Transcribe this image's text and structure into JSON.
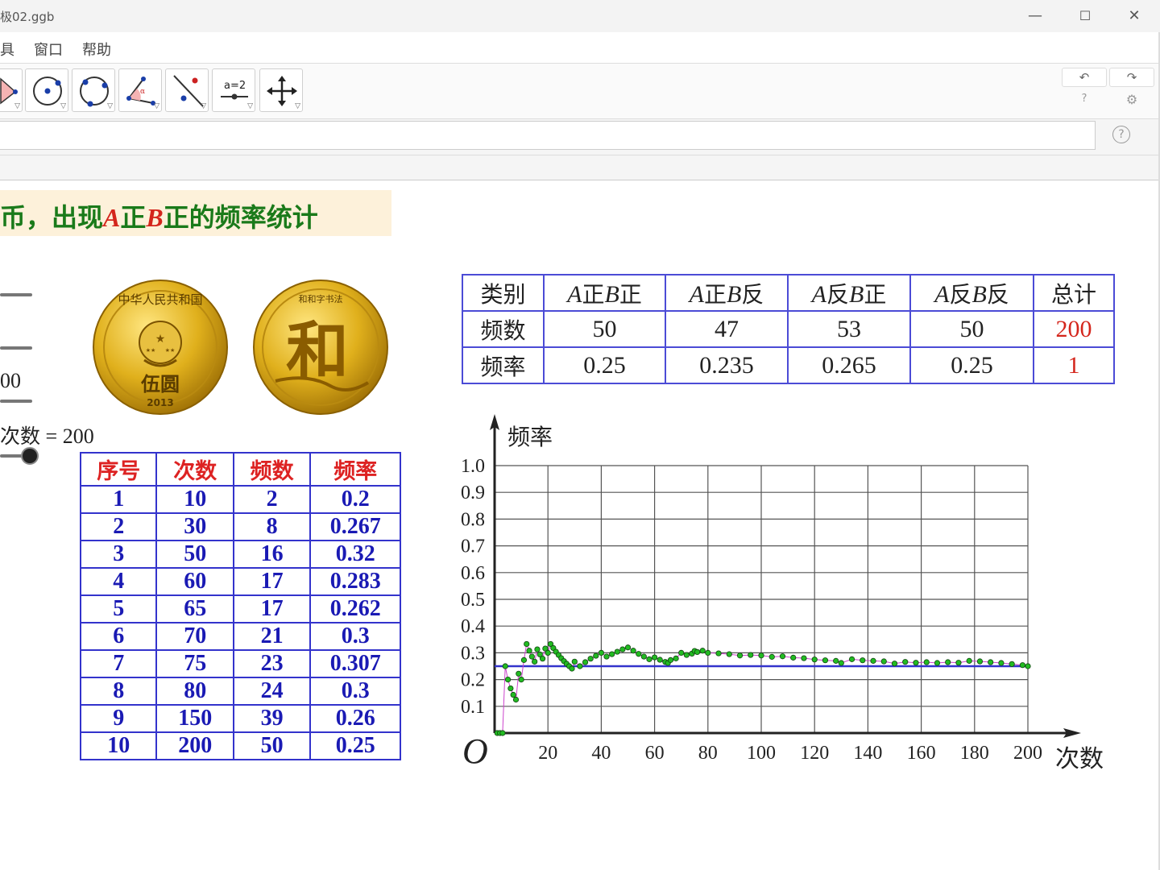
{
  "window": {
    "title": "极02.ggb",
    "minimize_glyph": "—",
    "maximize_glyph": "☐",
    "close_glyph": "✕"
  },
  "menu": {
    "items": [
      "具",
      "窗口",
      "帮助"
    ]
  },
  "toolbar": {
    "tools": [
      "angle-tool-icon",
      "circle-center-point-icon",
      "circle-three-points-icon",
      "angle-measure-icon",
      "reflect-line-icon",
      "slider-tool-icon",
      "move-graphics-view-icon"
    ],
    "slider_tool_label": "a=2",
    "undo_glyph": "↶",
    "redo_glyph": "↷",
    "help_glyph": "?",
    "settings_glyph": "⚙"
  },
  "input_bar": {
    "value": "",
    "help_glyph": "?"
  },
  "banner": {
    "prefix": "币，出现",
    "a": "A",
    "zheng1": "正",
    "b": "B",
    "suffix": "正的频率统计"
  },
  "slider_panel": {
    "value_fragment": "00",
    "trial_label": "次数",
    "trial_equals": "=",
    "trial_value": "200"
  },
  "coins": {
    "front_top_text": "中华人民共和国",
    "front_denomination": "伍圆",
    "front_year": "2013",
    "back_top_text": "和和字书法",
    "back_char": "和"
  },
  "left_table": {
    "headers": [
      "序号",
      "次数",
      "频数",
      "频率"
    ],
    "rows": [
      [
        "1",
        "10",
        "2",
        "0.2"
      ],
      [
        "2",
        "30",
        "8",
        "0.267"
      ],
      [
        "3",
        "50",
        "16",
        "0.32"
      ],
      [
        "4",
        "60",
        "17",
        "0.283"
      ],
      [
        "5",
        "65",
        "17",
        "0.262"
      ],
      [
        "6",
        "70",
        "21",
        "0.3"
      ],
      [
        "7",
        "75",
        "23",
        "0.307"
      ],
      [
        "8",
        "80",
        "24",
        "0.3"
      ],
      [
        "9",
        "150",
        "39",
        "0.26"
      ],
      [
        "10",
        "200",
        "50",
        "0.25"
      ]
    ]
  },
  "summary_table": {
    "header_label": "类别",
    "categories": [
      {
        "a": "A",
        "a_face": "正",
        "b": "B",
        "b_face": "正"
      },
      {
        "a": "A",
        "a_face": "正",
        "b": "B",
        "b_face": "反"
      },
      {
        "a": "A",
        "a_face": "反",
        "b": "B",
        "b_face": "正"
      },
      {
        "a": "A",
        "a_face": "反",
        "b": "B",
        "b_face": "反"
      }
    ],
    "total_label": "总计",
    "freq_label": "频数",
    "freq_values": [
      "50",
      "47",
      "53",
      "50"
    ],
    "freq_total": "200",
    "rate_label": "频率",
    "rate_values": [
      "0.25",
      "0.235",
      "0.265",
      "0.25"
    ],
    "rate_total": "1"
  },
  "chart_data": {
    "type": "scatter",
    "xlabel": "次数",
    "ylabel": "频率",
    "origin_label": "O",
    "xlim": [
      0,
      200
    ],
    "ylim": [
      0,
      1.0
    ],
    "x_ticks": [
      "20",
      "40",
      "60",
      "80",
      "100",
      "120",
      "140",
      "160",
      "180",
      "200"
    ],
    "y_ticks": [
      "0.1",
      "0.2",
      "0.3",
      "0.4",
      "0.5",
      "0.6",
      "0.7",
      "0.8",
      "0.9",
      "1.0"
    ],
    "grid": true,
    "reference_line_y": 0.25,
    "reference_color": "#3333cc",
    "point_color": "#22bb22",
    "connector_color": "#cc44cc",
    "points": [
      [
        1,
        0
      ],
      [
        2,
        0
      ],
      [
        3,
        0
      ],
      [
        4,
        0.25
      ],
      [
        5,
        0.2
      ],
      [
        6,
        0.167
      ],
      [
        7,
        0.143
      ],
      [
        8,
        0.125
      ],
      [
        9,
        0.222
      ],
      [
        10,
        0.2
      ],
      [
        11,
        0.273
      ],
      [
        12,
        0.333
      ],
      [
        13,
        0.308
      ],
      [
        14,
        0.286
      ],
      [
        15,
        0.267
      ],
      [
        16,
        0.313
      ],
      [
        17,
        0.294
      ],
      [
        18,
        0.278
      ],
      [
        19,
        0.316
      ],
      [
        20,
        0.3
      ],
      [
        21,
        0.333
      ],
      [
        22,
        0.318
      ],
      [
        23,
        0.304
      ],
      [
        24,
        0.292
      ],
      [
        25,
        0.28
      ],
      [
        26,
        0.269
      ],
      [
        27,
        0.259
      ],
      [
        28,
        0.25
      ],
      [
        29,
        0.241
      ],
      [
        30,
        0.267
      ],
      [
        32,
        0.25
      ],
      [
        34,
        0.265
      ],
      [
        36,
        0.278
      ],
      [
        38,
        0.289
      ],
      [
        40,
        0.3
      ],
      [
        42,
        0.286
      ],
      [
        44,
        0.295
      ],
      [
        46,
        0.304
      ],
      [
        48,
        0.313
      ],
      [
        50,
        0.32
      ],
      [
        52,
        0.308
      ],
      [
        54,
        0.296
      ],
      [
        56,
        0.286
      ],
      [
        58,
        0.276
      ],
      [
        60,
        0.283
      ],
      [
        62,
        0.274
      ],
      [
        64,
        0.266
      ],
      [
        65,
        0.262
      ],
      [
        66,
        0.273
      ],
      [
        68,
        0.279
      ],
      [
        70,
        0.3
      ],
      [
        72,
        0.292
      ],
      [
        74,
        0.297
      ],
      [
        75,
        0.307
      ],
      [
        76,
        0.303
      ],
      [
        78,
        0.308
      ],
      [
        80,
        0.3
      ],
      [
        84,
        0.298
      ],
      [
        88,
        0.295
      ],
      [
        92,
        0.29
      ],
      [
        96,
        0.292
      ],
      [
        100,
        0.29
      ],
      [
        104,
        0.285
      ],
      [
        108,
        0.287
      ],
      [
        112,
        0.282
      ],
      [
        116,
        0.28
      ],
      [
        120,
        0.275
      ],
      [
        124,
        0.272
      ],
      [
        128,
        0.27
      ],
      [
        130,
        0.262
      ],
      [
        134,
        0.276
      ],
      [
        138,
        0.272
      ],
      [
        142,
        0.27
      ],
      [
        146,
        0.268
      ],
      [
        150,
        0.26
      ],
      [
        154,
        0.266
      ],
      [
        158,
        0.263
      ],
      [
        162,
        0.265
      ],
      [
        166,
        0.262
      ],
      [
        170,
        0.265
      ],
      [
        174,
        0.263
      ],
      [
        178,
        0.27
      ],
      [
        182,
        0.268
      ],
      [
        186,
        0.265
      ],
      [
        190,
        0.262
      ],
      [
        194,
        0.258
      ],
      [
        198,
        0.254
      ],
      [
        200,
        0.25
      ]
    ]
  }
}
